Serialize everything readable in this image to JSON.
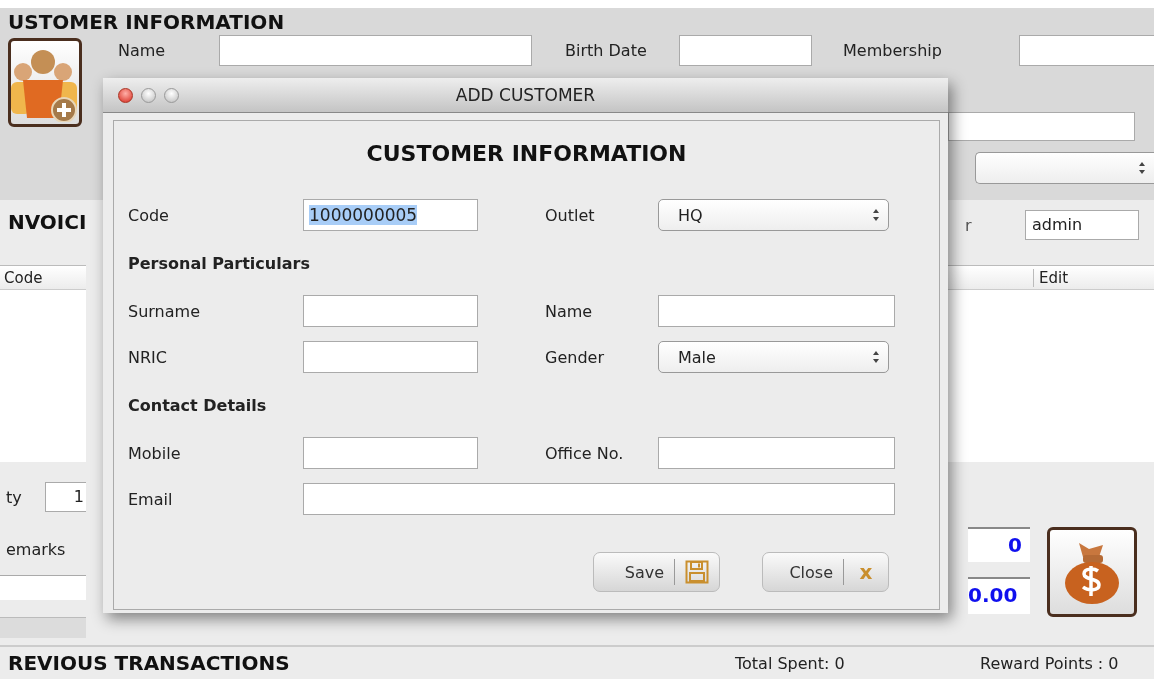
{
  "main": {
    "heading": "USTOMER INFORMATION",
    "labels": [
      "Name",
      "Birth Date",
      "Membership"
    ]
  },
  "invoice": {
    "heading": "NVOICI",
    "user_label": "r",
    "user_value": "admin",
    "columns": [
      "Code",
      "Edit"
    ],
    "quantity_label": "ty",
    "quantity_value": "1",
    "remarks_label": "emarks",
    "count_value": "0",
    "total_value": "0.00"
  },
  "previous": {
    "heading": "REVIOUS TRANSACTIONS",
    "total_spent": "Total Spent: 0",
    "reward_points": "Reward Points : 0"
  },
  "dialog": {
    "title": "ADD CUSTOMER",
    "heading": "CUSTOMER INFORMATION",
    "rows": [
      {
        "kind": "pair",
        "cells": [
          {
            "kind": "text",
            "label": "Code",
            "value": "1000000005",
            "highlighted": true
          },
          {
            "kind": "select",
            "label": "Outlet",
            "value": "HQ"
          }
        ]
      },
      {
        "kind": "section",
        "label": "Personal Particulars"
      },
      {
        "kind": "pair",
        "cells": [
          {
            "kind": "text",
            "label": "Surname"
          },
          {
            "kind": "text",
            "label": "Name"
          }
        ]
      },
      {
        "kind": "pair",
        "cells": [
          {
            "kind": "text",
            "label": "NRIC"
          },
          {
            "kind": "select",
            "label": "Gender",
            "value": "Male"
          }
        ]
      },
      {
        "kind": "section",
        "label": "Contact Details"
      },
      {
        "kind": "pair",
        "cells": [
          {
            "kind": "text",
            "label": "Mobile"
          },
          {
            "kind": "text",
            "label": "Office No."
          }
        ]
      },
      {
        "kind": "wide",
        "cells": [
          {
            "kind": "text",
            "label": "Email"
          }
        ]
      }
    ],
    "buttons": [
      {
        "label": "Save",
        "kind": "floppy"
      },
      {
        "label": "Close",
        "kind": "glyph",
        "glyph": "x"
      }
    ]
  }
}
